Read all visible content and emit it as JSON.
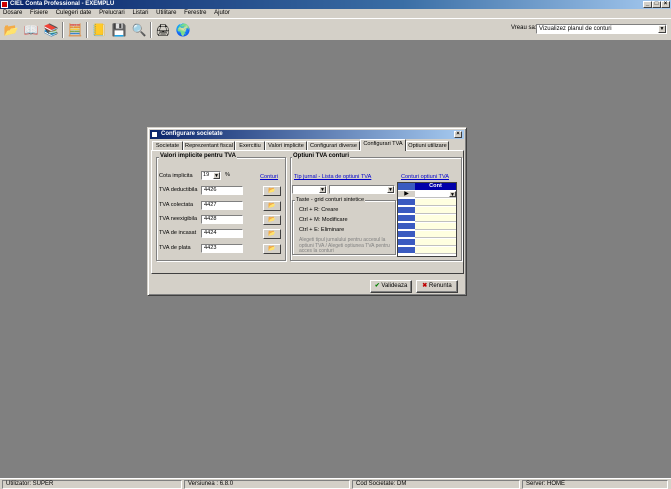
{
  "window": {
    "title": "CIEL Conta Professional - EXEMPLU"
  },
  "menu": [
    "Dosare",
    "Fisiere",
    "Culegeri date",
    "Prelucrari",
    "Listari",
    "Utilitare",
    "Ferestre",
    "Ajutor"
  ],
  "toolbar": {
    "icons": [
      "open-folder-icon",
      "book-icon",
      "stack-icon",
      "calculator-icon",
      "ledger-icon",
      "diskette-icon",
      "search-icon",
      "printer-icon",
      "globe-icon"
    ],
    "vreau_label": "Vreau sa:",
    "vreau_value": "Vizualizez planul de conturi"
  },
  "dialog": {
    "title": "Configurare societate",
    "tabs": [
      "Societate",
      "Reprezentant fiscal",
      "Exercitiu",
      "Valori implicite",
      "Configurari diverse",
      "Configurari TVA",
      "Optiuni utilizare"
    ],
    "active_tab": "Configurari TVA",
    "left_group": {
      "title": "Valori implicite pentru TVA",
      "cota_label": "Cota implicita",
      "cota_value": "19",
      "percent": "%",
      "conturi_link": "Conturi",
      "rows": [
        {
          "label": "TVA deductibila",
          "value": "4426"
        },
        {
          "label": "TVA colectata",
          "value": "4427"
        },
        {
          "label": "TVA neexigibila",
          "value": "4428"
        },
        {
          "label": "TVA de incasat",
          "value": "4424"
        },
        {
          "label": "TVA de plata",
          "value": "4423"
        }
      ]
    },
    "right_group": {
      "title": "Optiuni TVA conturi",
      "tip_link": "Tip jurnal - Lista de optiuni TVA",
      "conturi_link": "Conturi optiuni TVA",
      "taste_title": "Taste - grid conturi sintetice",
      "taste": [
        "Ctrl + R: Creare",
        "Ctrl + M: Modificare",
        "Ctrl + E: Eliminare"
      ],
      "hint": "Alegeti tipul jurnalului pentru accesul la optiuni TVA / Alegeti optiunea TVA pentru acces la conturi",
      "grid_header": "Cont"
    },
    "buttons": {
      "ok": "Valideaza",
      "cancel": "Renunta"
    }
  },
  "statusbar": {
    "user": "Utilizator: SUPER",
    "version": "Versiunea : 6.8.0",
    "company": "Cod Societate: DM",
    "server": "Server: HOME"
  }
}
